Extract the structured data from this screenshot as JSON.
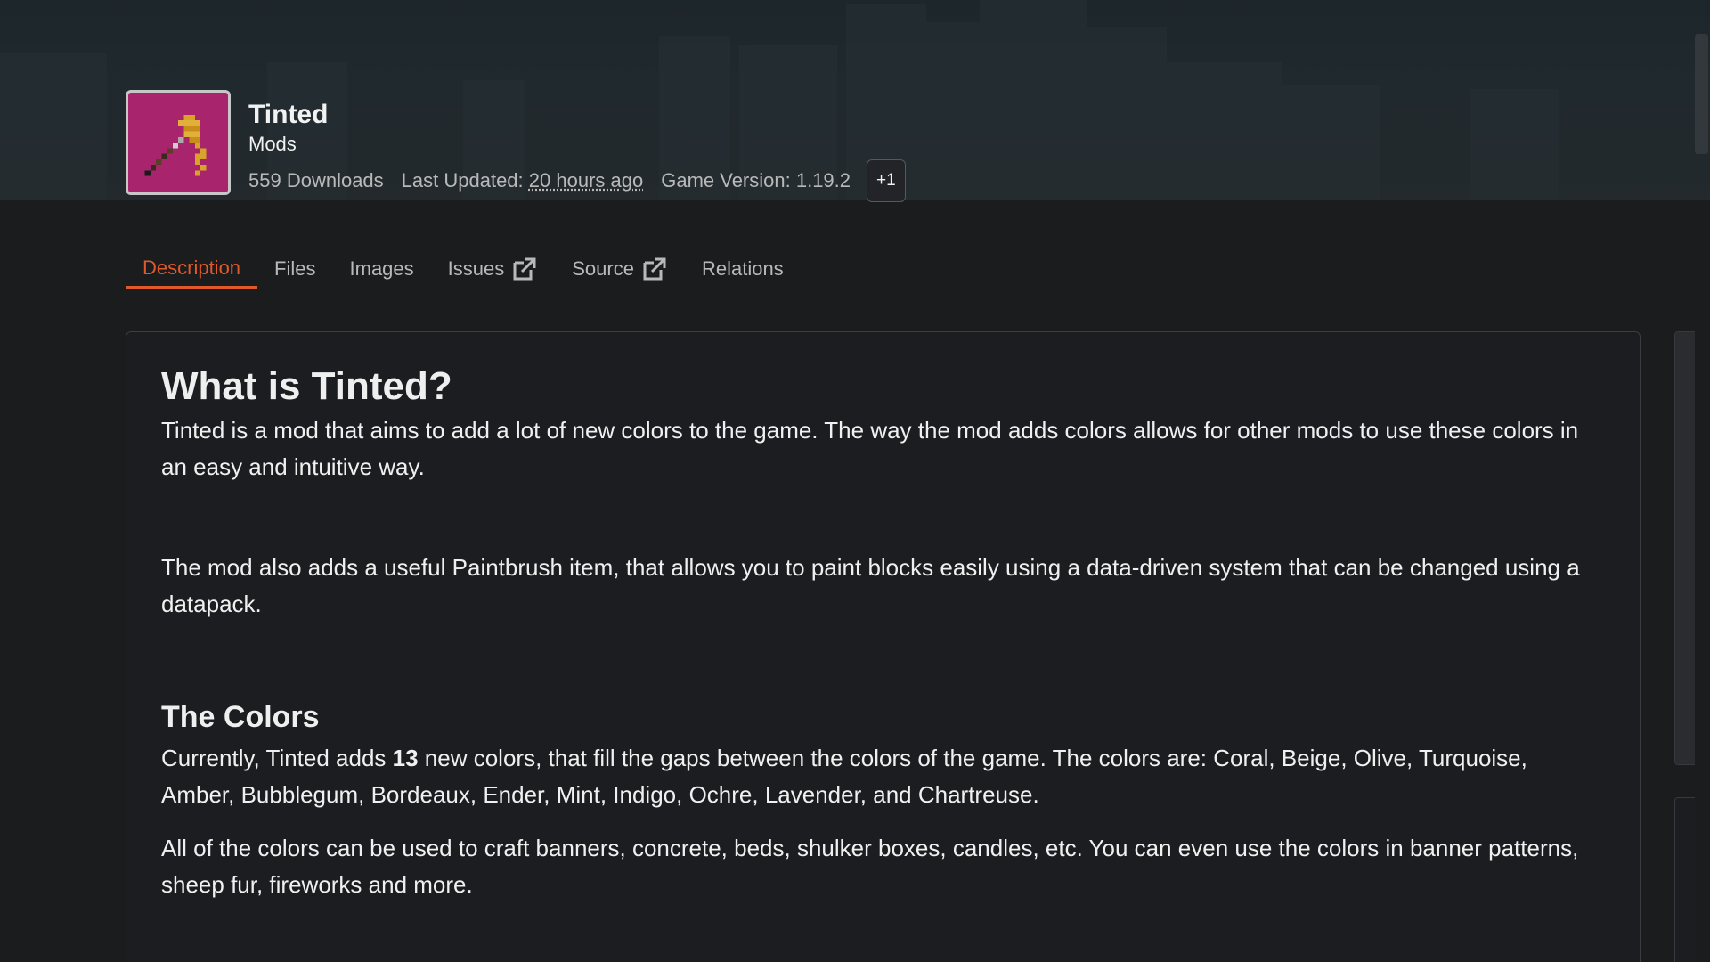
{
  "project": {
    "title": "Tinted",
    "category": "Mods",
    "downloads": "559 Downloads",
    "last_updated_label": "Last Updated:",
    "last_updated_value": "20 hours ago",
    "game_version": "Game Version: 1.19.2",
    "more_versions": "+1"
  },
  "tabs": [
    {
      "label": "Description",
      "active": true
    },
    {
      "label": "Files"
    },
    {
      "label": "Images"
    },
    {
      "label": "Issues",
      "icon": "external-link-icon"
    },
    {
      "label": "Source",
      "icon": "external-link-icon"
    },
    {
      "label": "Relations"
    }
  ],
  "content": {
    "heading": "What is Tinted?",
    "paragraph1": "Tinted is a mod that aims to add a lot of new colors to the game. The way the mod adds colors allows for other mods to use these colors in an easy and intuitive way.",
    "paragraph2": "The mod also adds a useful Paintbrush item, that allows you to paint blocks easily using a data-driven system that can be changed using a datapack.",
    "colors_heading": "The Colors",
    "colors_p_before": "Currently, Tinted adds ",
    "colors_count": "13",
    "colors_p_after": " new colors, that fill the gaps between the colors of the game. The colors are: Coral, Beige, Olive, Turquoise, Amber, Bubblegum, Bordeaux, Ender, Mint, Indigo, Ochre, Lavender, and Chartreuse.",
    "paragraph4": "All of the colors can be used to craft banners, concrete, beds, shulker boxes, candles, etc. You can even use the colors in banner patterns, sheep fur, fireworks and more."
  },
  "colors": {
    "accent": "#e0592a",
    "avatar_bg": "#a8246d",
    "background": "#1b1c1e"
  },
  "icons": {
    "avatar": "paintbrush-icon",
    "external": "external-link-icon"
  }
}
